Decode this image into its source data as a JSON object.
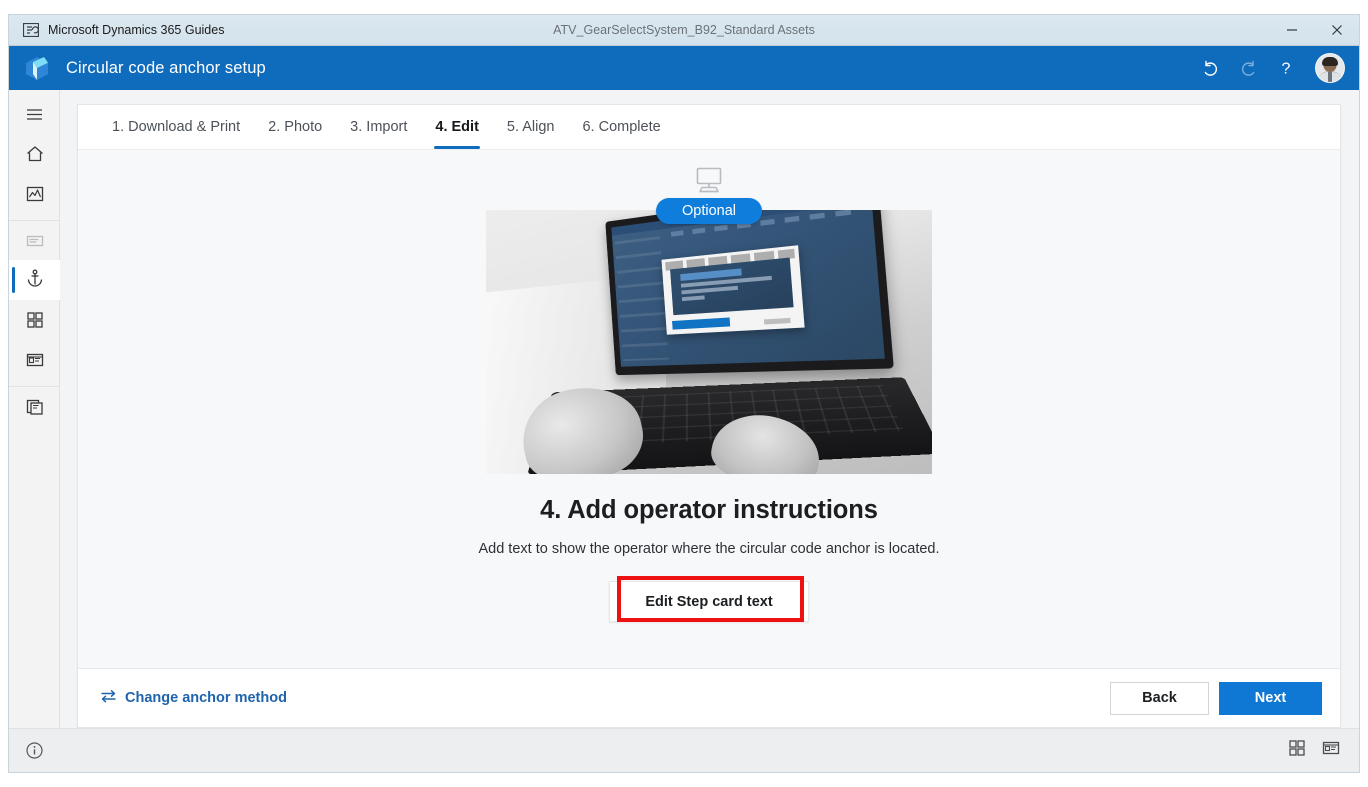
{
  "window": {
    "app_name": "Microsoft Dynamics 365 Guides",
    "document_title": "ATV_GearSelectSystem_B92_Standard Assets",
    "minimize_label": "—",
    "close_label": "✕",
    "app_mini_icon": "guides-app-icon"
  },
  "command_bar": {
    "logo_icon": "dynamics-guides-logo",
    "title": "Circular code anchor setup",
    "undo_icon": "undo-icon",
    "redo_icon": "redo-icon",
    "help_label": "?",
    "help_icon": "help-icon",
    "avatar_label": "user-avatar",
    "accent_color": "#0f6cbd"
  },
  "rail": {
    "items": [
      {
        "name": "menu-icon",
        "label": "Menu",
        "state": "normal"
      },
      {
        "name": "home-icon",
        "label": "Home",
        "state": "normal"
      },
      {
        "name": "analytics-icon",
        "label": "Analytics",
        "state": "normal"
      },
      {
        "name": "text-card-icon",
        "label": "Text card",
        "state": "disabled"
      },
      {
        "name": "anchor-icon",
        "label": "Anchor",
        "state": "active"
      },
      {
        "name": "apps-grid-icon",
        "label": "Apps",
        "state": "normal"
      },
      {
        "name": "step-card-icon",
        "label": "Step card",
        "state": "normal"
      },
      {
        "name": "duplicate-icon",
        "label": "Duplicate",
        "state": "normal"
      }
    ]
  },
  "tabs": [
    {
      "label": "1. Download & Print",
      "active": false
    },
    {
      "label": "2. Photo",
      "active": false
    },
    {
      "label": "3. Import",
      "active": false
    },
    {
      "label": "4. Edit",
      "active": true
    },
    {
      "label": "5. Align",
      "active": false
    },
    {
      "label": "6. Complete",
      "active": false
    }
  ],
  "content": {
    "monitor_icon": "monitor-icon",
    "badge_label": "Optional",
    "badge_color": "#0f7ddb",
    "photo_alt": "hands typing on a laptop running the guides app",
    "heading": "4. Add operator instructions",
    "subtext": "Add text to show the operator where the circular code anchor is located.",
    "edit_button_label": "Edit Step card text",
    "highlight_color": "#ee1111"
  },
  "footer": {
    "change_method_icon": "swap-arrows-icon",
    "change_method_label": "Change anchor method",
    "back_label": "Back",
    "next_label": "Next"
  },
  "statusbar": {
    "info_icon": "info-circle-icon",
    "grid_icon": "apps-grid-icon",
    "card_icon": "step-card-icon"
  }
}
